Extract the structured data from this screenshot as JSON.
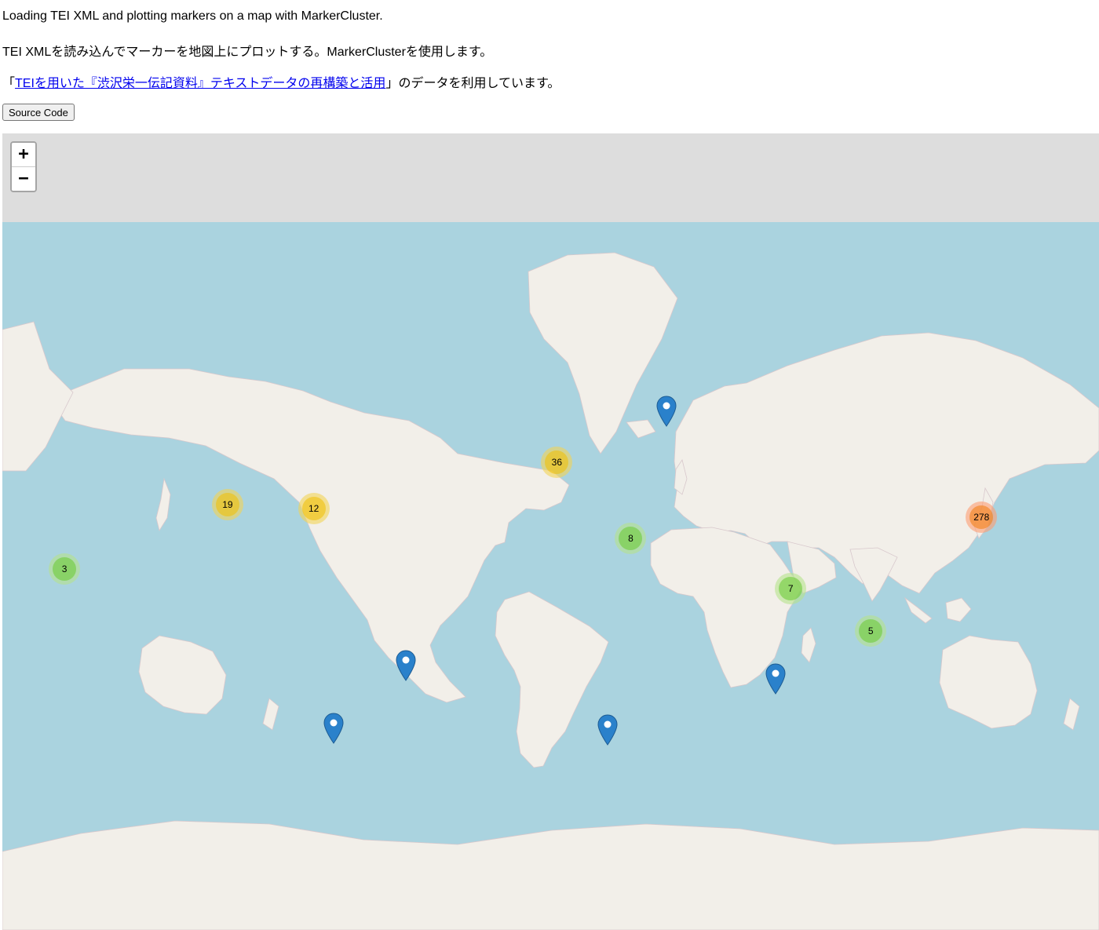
{
  "intro": {
    "line1": "Loading TEI XML and plotting markers on a map with MarkerCluster.",
    "line2": "TEI XMLを読み込んでマーカーを地図上にプロットする。MarkerClusterを使用します。",
    "line3_prefix": "「",
    "line3_link": "TEIを用いた『渋沢栄一伝記資料』テキストデータの再構築と活用",
    "line3_suffix": "」のデータを利用しています。"
  },
  "source_button": "Source Code",
  "zoom": {
    "in": "+",
    "out": "−"
  },
  "colors": {
    "ocean": "#aad3df",
    "land": "#f2efe9",
    "empty_tile": "#dddddd",
    "link": "#0000ee",
    "pin": "#2a81cb"
  },
  "map_info": {
    "tiles": "openstreetmap",
    "projection": "web-mercator",
    "center_lon": 0
  },
  "clusters": [
    {
      "count": "19",
      "size": "medium",
      "lon": -105,
      "lat": 39
    },
    {
      "count": "12",
      "size": "medium",
      "lon": -77,
      "lat": 38
    },
    {
      "count": "3",
      "size": "small",
      "lon": -158,
      "lat": 21
    },
    {
      "count": "36",
      "size": "medium",
      "lon": 2,
      "lat": 48.9
    },
    {
      "count": "8",
      "size": "small",
      "lon": 26,
      "lat": 30
    },
    {
      "count": "7",
      "size": "small",
      "lon": 78,
      "lat": 15
    },
    {
      "count": "5",
      "size": "small",
      "lon": 104,
      "lat": 1.3
    },
    {
      "count": "278",
      "size": "large",
      "lon": 140,
      "lat": 35.7
    }
  ],
  "markers": [
    {
      "name": "moscow",
      "lon": 37.6,
      "lat": 55.8
    },
    {
      "name": "brazil",
      "lon": -47,
      "lat": -15
    },
    {
      "name": "chile",
      "lon": -70.6,
      "lat": -33.4
    },
    {
      "name": "cape-town",
      "lon": 18.4,
      "lat": -33.9
    },
    {
      "name": "indian-ocean",
      "lon": 73,
      "lat": -19
    }
  ]
}
